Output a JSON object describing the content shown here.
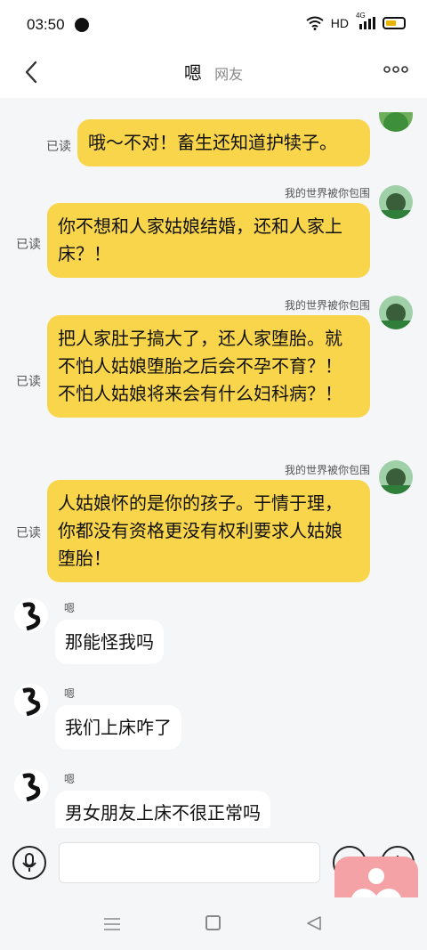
{
  "status_bar": {
    "time": "03:50",
    "network": "HD",
    "signal": "4G",
    "icons": [
      "globe-icon",
      "wifi-icon",
      "signal-icon",
      "battery-icon"
    ]
  },
  "header": {
    "title": "嗯",
    "subtitle": "网友",
    "icons": [
      "back-arrow-icon",
      "more-icon"
    ]
  },
  "colors": {
    "my_bubble": "#f9d54c",
    "their_bubble": "#ffffff",
    "background": "#f5f6f8",
    "heart_button": "#f4a2a5"
  },
  "messages_out": [
    {
      "read": "已读",
      "sender": "",
      "text": "哦～不对！畜生还知道护犊子。"
    },
    {
      "read": "已读",
      "sender": "我的世界被你包围",
      "text": "你不想和人家姑娘结婚，还和人家上床？！"
    },
    {
      "read": "已读",
      "sender": "我的世界被你包围",
      "text": "把人家肚子搞大了，还人家堕胎。就不怕人姑娘堕胎之后会不孕不育？！不怕人姑娘将来会有什么妇科病？！"
    },
    {
      "read": "已读",
      "sender": "我的世界被你包围",
      "text": "人姑娘怀的是你的孩子。于情于理，你都没有资格更没有权利要求人姑娘堕胎！"
    }
  ],
  "messages_in": [
    {
      "sender": "嗯",
      "text": "那能怪我吗"
    },
    {
      "sender": "嗯",
      "text": "我们上床咋了"
    },
    {
      "sender": "嗯",
      "text": "男女朋友上床不很正常吗"
    }
  ],
  "input": {
    "placeholder": "",
    "icons": [
      "voice-icon",
      "emoji-icon",
      "plus-icon",
      "heart-icon"
    ]
  },
  "nav": {
    "icons": [
      "menu-icon",
      "home-icon",
      "back-icon"
    ]
  }
}
